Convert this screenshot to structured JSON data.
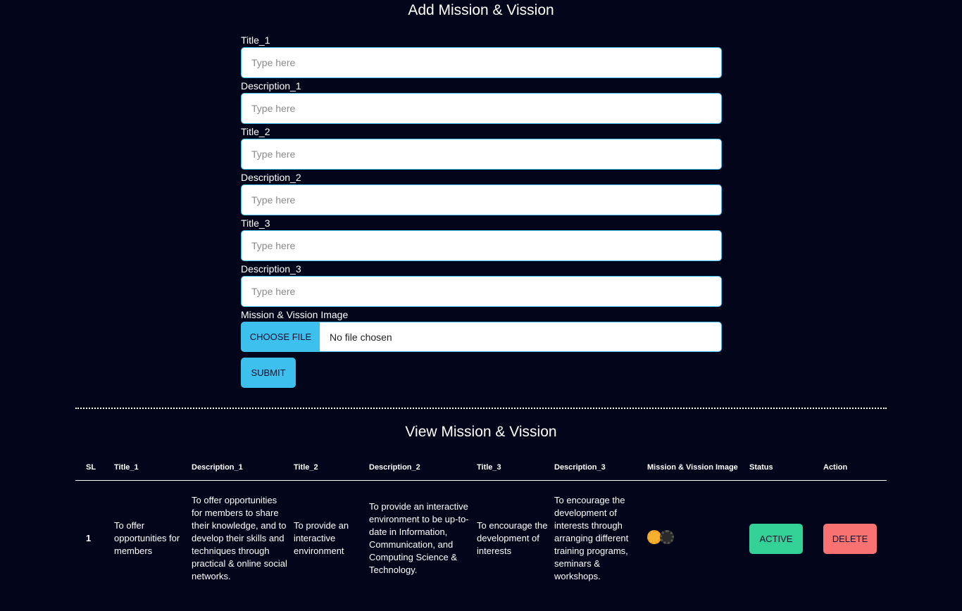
{
  "form": {
    "title": "Add Mission & Vission",
    "fields": [
      {
        "label": "Title_1",
        "placeholder": "Type here"
      },
      {
        "label": "Description_1",
        "placeholder": "Type here"
      },
      {
        "label": "Title_2",
        "placeholder": "Type here"
      },
      {
        "label": "Description_2",
        "placeholder": "Type here"
      },
      {
        "label": "Title_3",
        "placeholder": "Type here"
      },
      {
        "label": "Description_3",
        "placeholder": "Type here"
      }
    ],
    "image_label": "Mission & Vission Image",
    "choose_file_label": "CHOOSE FILE",
    "file_status": "No file chosen",
    "submit_label": "SUBMIT"
  },
  "view": {
    "title": "View Mission & Vission",
    "columns": [
      "SL",
      "Title_1",
      "Description_1",
      "Title_2",
      "Description_2",
      "Title_3",
      "Description_3",
      "Mission & Vission Image",
      "Status",
      "Action"
    ],
    "rows": [
      {
        "sl": "1",
        "title_1": "To offer opportunities for members",
        "description_1": "To offer opportunities for members to share their knowledge, and to develop their skills and techniques through practical & online social networks.",
        "title_2": "To provide an interactive environment",
        "description_2": "To provide an interactive environment to be up-to-date in Information, Communication, and Computing Science & Technology.",
        "title_3": "To encourage the development of interests",
        "description_3": "To encourage the development of interests through arranging different training programs, seminars & workshops.",
        "image_icon": "gears-icon",
        "status": "ACTIVE",
        "action": "DELETE"
      }
    ]
  },
  "colors": {
    "background": "#03061a",
    "accent": "#3ec0ee",
    "active": "#33d195",
    "delete": "#f87272"
  }
}
